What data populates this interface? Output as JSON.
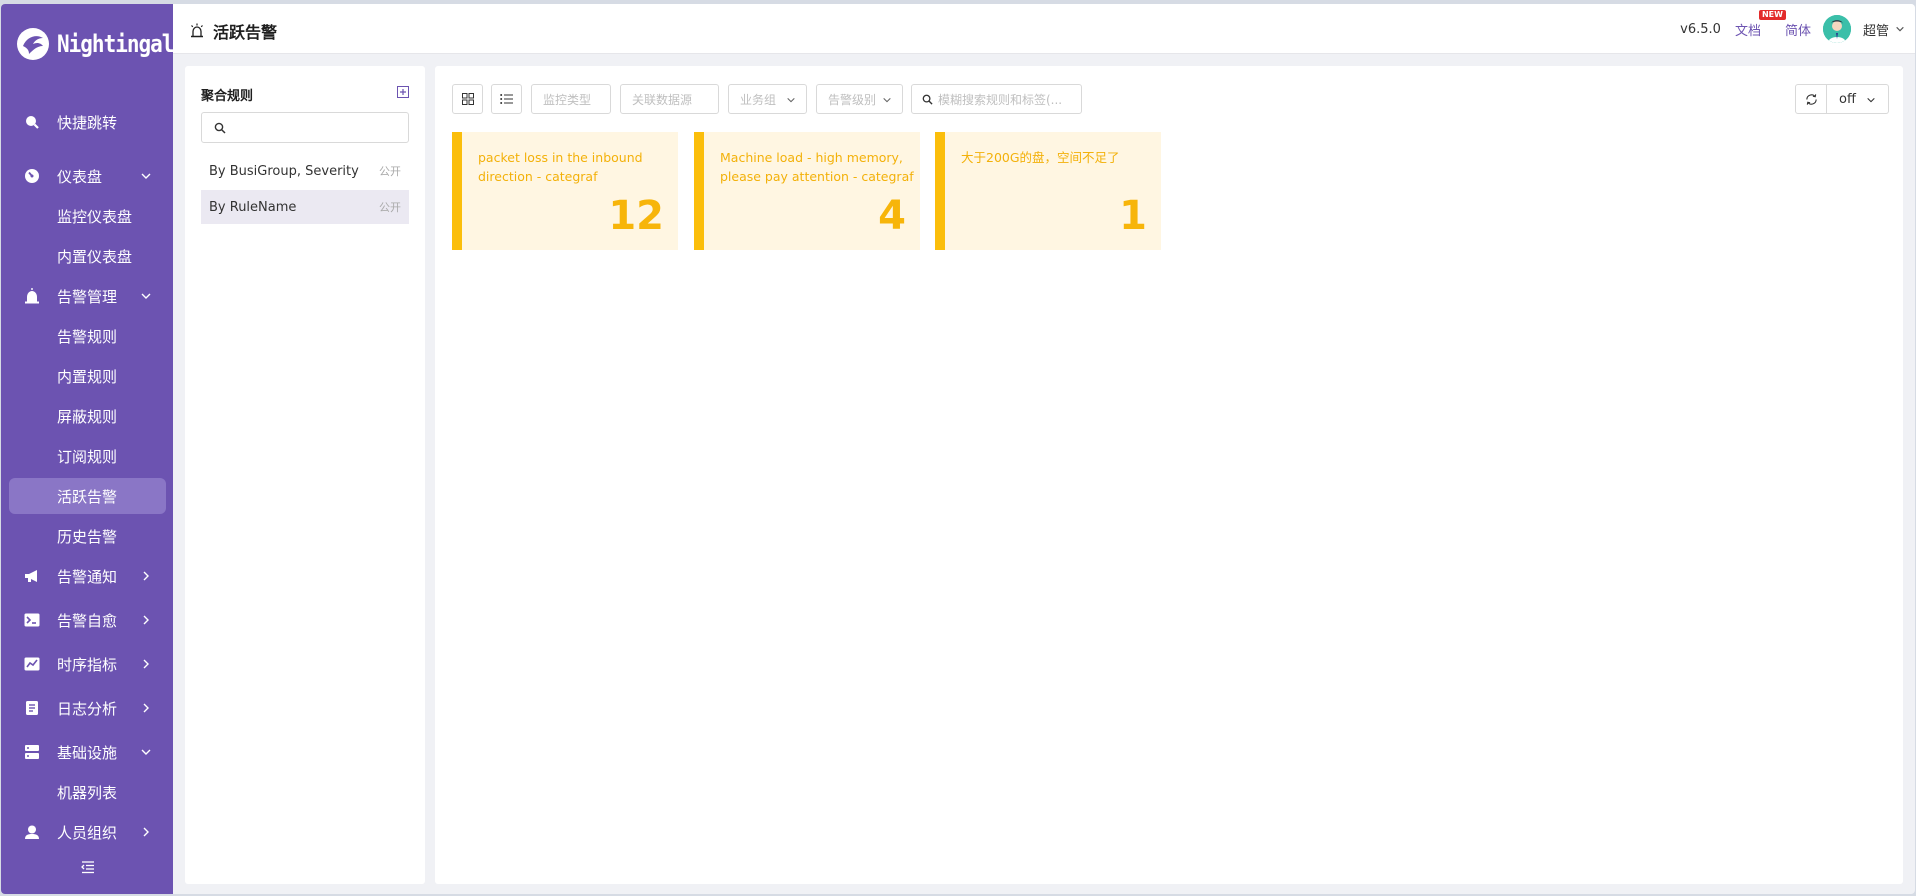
{
  "app": {
    "logo_text": "Nightingale"
  },
  "sidebar": {
    "items": [
      {
        "label": "快捷跳转",
        "icon": "search-icon"
      },
      {
        "label": "仪表盘",
        "icon": "dashboard-icon",
        "expanded": true,
        "children": [
          "监控仪表盘",
          "内置仪表盘"
        ]
      },
      {
        "label": "告警管理",
        "icon": "alarm-icon",
        "expanded": true,
        "children": [
          "告警规则",
          "内置规则",
          "屏蔽规则",
          "订阅规则",
          "活跃告警",
          "历史告警"
        ]
      },
      {
        "label": "告警通知",
        "icon": "megaphone-icon"
      },
      {
        "label": "告警自愈",
        "icon": "terminal-icon"
      },
      {
        "label": "时序指标",
        "icon": "chart-icon"
      },
      {
        "label": "日志分析",
        "icon": "log-icon"
      },
      {
        "label": "基础设施",
        "icon": "server-icon",
        "expanded": true,
        "children": [
          "机器列表"
        ]
      },
      {
        "label": "人员组织",
        "icon": "user-icon"
      }
    ],
    "active_item": "活跃告警"
  },
  "header": {
    "title": "活跃告警",
    "version": "v6.5.0",
    "docs_label": "文档",
    "new_badge": "NEW",
    "language": "简体",
    "username": "超管"
  },
  "left_panel": {
    "title": "聚合规则",
    "search_placeholder": "",
    "rules": [
      {
        "name": "By BusiGroup, Severity",
        "tag": "公开"
      },
      {
        "name": "By RuleName",
        "tag": "公开"
      }
    ],
    "selected_rule": "By RuleName"
  },
  "toolbar": {
    "monitor_type_placeholder": "监控类型",
    "datasource_placeholder": "关联数据源",
    "busi_group_placeholder": "业务组",
    "severity_placeholder": "告警级别",
    "search_placeholder": "模糊搜索规则和标签(...",
    "refresh_interval": "off"
  },
  "cards": [
    {
      "name": "packet loss in the inbound direction - categraf",
      "count": "12"
    },
    {
      "name": "Machine load - high memory, please pay attention - categraf",
      "count": "4"
    },
    {
      "name": "大于200G的盘，空间不足了",
      "count": "1"
    }
  ],
  "colors": {
    "sidebar_bg": "#6c53b1",
    "accent": "#6c53b1",
    "card_bg": "#fff6e2",
    "card_bar": "#fbbe0b",
    "card_text": "#f3b10a"
  }
}
